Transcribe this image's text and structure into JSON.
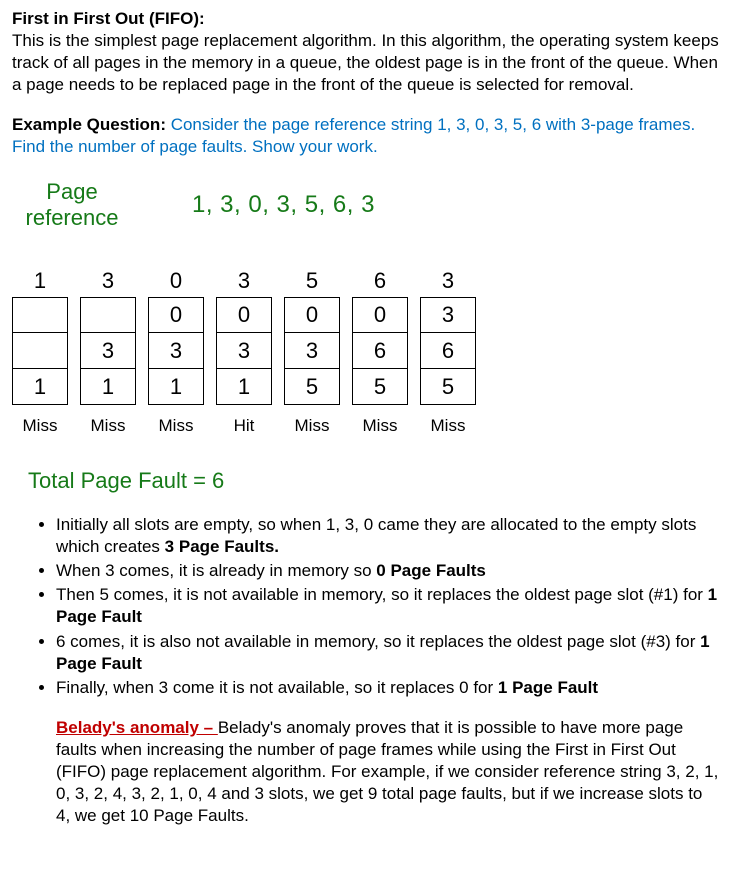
{
  "heading": "First in First Out (FIFO):",
  "description": "This is the simplest page replacement algorithm. In this algorithm, the operating system keeps track of all pages in the memory in a queue, the oldest page is in the front of the queue. When a page needs to be replaced page in the front of the queue is selected for removal.",
  "example_label": "Example Question: ",
  "example_text": "Consider the page reference string 1, 3, 0, 3, 5, 6 with 3-page frames. Find the number of page faults. Show your work.",
  "diagram": {
    "label_line1": "Page",
    "label_line2": "reference",
    "sequence": "1, 3, 0, 3, 5, 6, 3",
    "columns": [
      {
        "ref": "1",
        "slots": [
          "",
          "",
          "1"
        ],
        "status": "Miss"
      },
      {
        "ref": "3",
        "slots": [
          "",
          "3",
          "1"
        ],
        "status": "Miss"
      },
      {
        "ref": "0",
        "slots": [
          "0",
          "3",
          "1"
        ],
        "status": "Miss"
      },
      {
        "ref": "3",
        "slots": [
          "0",
          "3",
          "1"
        ],
        "status": "Hit"
      },
      {
        "ref": "5",
        "slots": [
          "0",
          "3",
          "5"
        ],
        "status": "Miss"
      },
      {
        "ref": "6",
        "slots": [
          "0",
          "6",
          "5"
        ],
        "status": "Miss"
      },
      {
        "ref": "3",
        "slots": [
          "3",
          "6",
          "5"
        ],
        "status": "Miss"
      }
    ]
  },
  "total": "Total Page Fault = 6",
  "explanation": [
    {
      "pre": "Initially all slots are empty, so when 1, 3, 0 came they are allocated to the empty slots which creates ",
      "bold": "3 Page Faults.",
      "post": ""
    },
    {
      "pre": "When 3 comes, it is already in memory so ",
      "bold": "0 Page Faults",
      "post": ""
    },
    {
      "pre": "Then 5 comes, it is not available in memory, so it replaces the oldest page slot (#1) for ",
      "bold": "1 Page Fault",
      "post": ""
    },
    {
      "pre": "6 comes, it is also not available in memory, so it replaces the oldest page slot (#3) for ",
      "bold": "1 Page Fault",
      "post": ""
    },
    {
      "pre": "Finally, when 3 come it is not available, so it replaces 0 for ",
      "bold": "1 Page Fault",
      "post": ""
    }
  ],
  "anomaly": {
    "title": "Belady's anomaly – ",
    "text": "Belady's anomaly proves that it is possible to have more page faults when increasing the number of page frames while using the First in First Out (FIFO) page replacement algorithm.  For example, if we consider reference string 3, 2, 1, 0, 3, 2, 4, 3, 2, 1, 0, 4 and 3 slots, we get 9 total page faults, but if we increase slots to 4, we get 10 Page Faults."
  }
}
